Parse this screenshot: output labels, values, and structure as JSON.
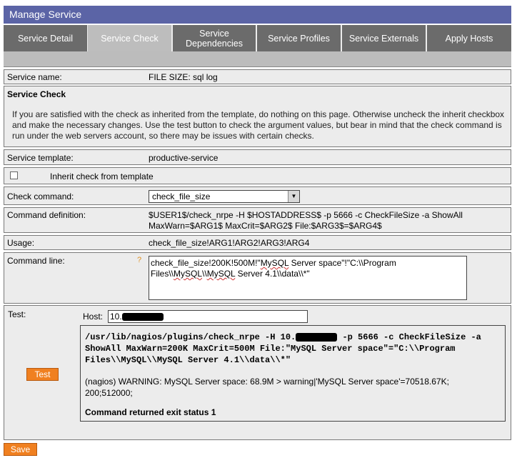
{
  "window": {
    "title": "Manage Service"
  },
  "tabs": [
    {
      "label": "Service Detail",
      "active": false
    },
    {
      "label": "Service Check",
      "active": true
    },
    {
      "label": "Service Dependencies",
      "active": false
    },
    {
      "label": "Service Profiles",
      "active": false
    },
    {
      "label": "Service Externals",
      "active": false
    },
    {
      "label": "Apply Hosts",
      "active": false
    }
  ],
  "service_name": {
    "label": "Service name:",
    "value": "FILE SIZE: sql log"
  },
  "service_check": {
    "heading": "Service Check",
    "description": "If you are satisfied with the check as inherited from the template, do nothing on this page. Otherwise uncheck the inherit checkbox and make the necessary changes. Use the test button to check the argument values, but bear in mind that the check command is run under the web servers account, so there may be issues with certain checks."
  },
  "service_template": {
    "label": "Service template:",
    "value": "productive-service"
  },
  "inherit": {
    "label": "Inherit check from template",
    "checked": false
  },
  "check_command": {
    "label": "Check command:",
    "selected": "check_file_size"
  },
  "command_definition": {
    "label": "Command definition:",
    "line1": "$USER1$/check_nrpe -H $HOSTADDRESS$ -p 5666 -c CheckFileSize -a ShowAll",
    "line2": "MaxWarn=$ARG1$ MaxCrit=$ARG2$ File:$ARG3$=$ARG4$"
  },
  "usage": {
    "label": "Usage:",
    "value": "check_file_size!ARG1!ARG2!ARG3!ARG4"
  },
  "command_line": {
    "label": "Command line:",
    "help": "?",
    "part1": "check_file_size!200K!500M!\"",
    "w1": "MySQL",
    "part2": " Server space\"!\"C:\\\\Program Files\\\\",
    "w2": "MySQL",
    "part3": "\\\\",
    "w3": "MySQL",
    "part4": " Server 4.1\\\\data\\\\*\""
  },
  "test": {
    "label": "Test:",
    "host_label": "Host:",
    "host_prefix": "10.",
    "button": "Test",
    "cmd_prefix": "/usr/lib/nagios/plugins/check_nrpe -H 10.",
    "cmd_suffix": " -p 5666 -c CheckFileSize -a",
    "cmd_line2": "ShowAll MaxWarn=200K MaxCrit=500M File:\"MySQL Server space\"=\"C:\\\\Program",
    "cmd_line3": "Files\\\\MySQL\\\\MySQL Server 4.1\\\\data\\\\*\"",
    "result_line1": "(nagios) WARNING: MySQL Server space: 68.9M > warning|'MySQL Server space'=70518.67K;",
    "result_line2": "200;512000;",
    "exit_status": "Command returned exit status 1"
  },
  "footer": {
    "save": "Save"
  }
}
